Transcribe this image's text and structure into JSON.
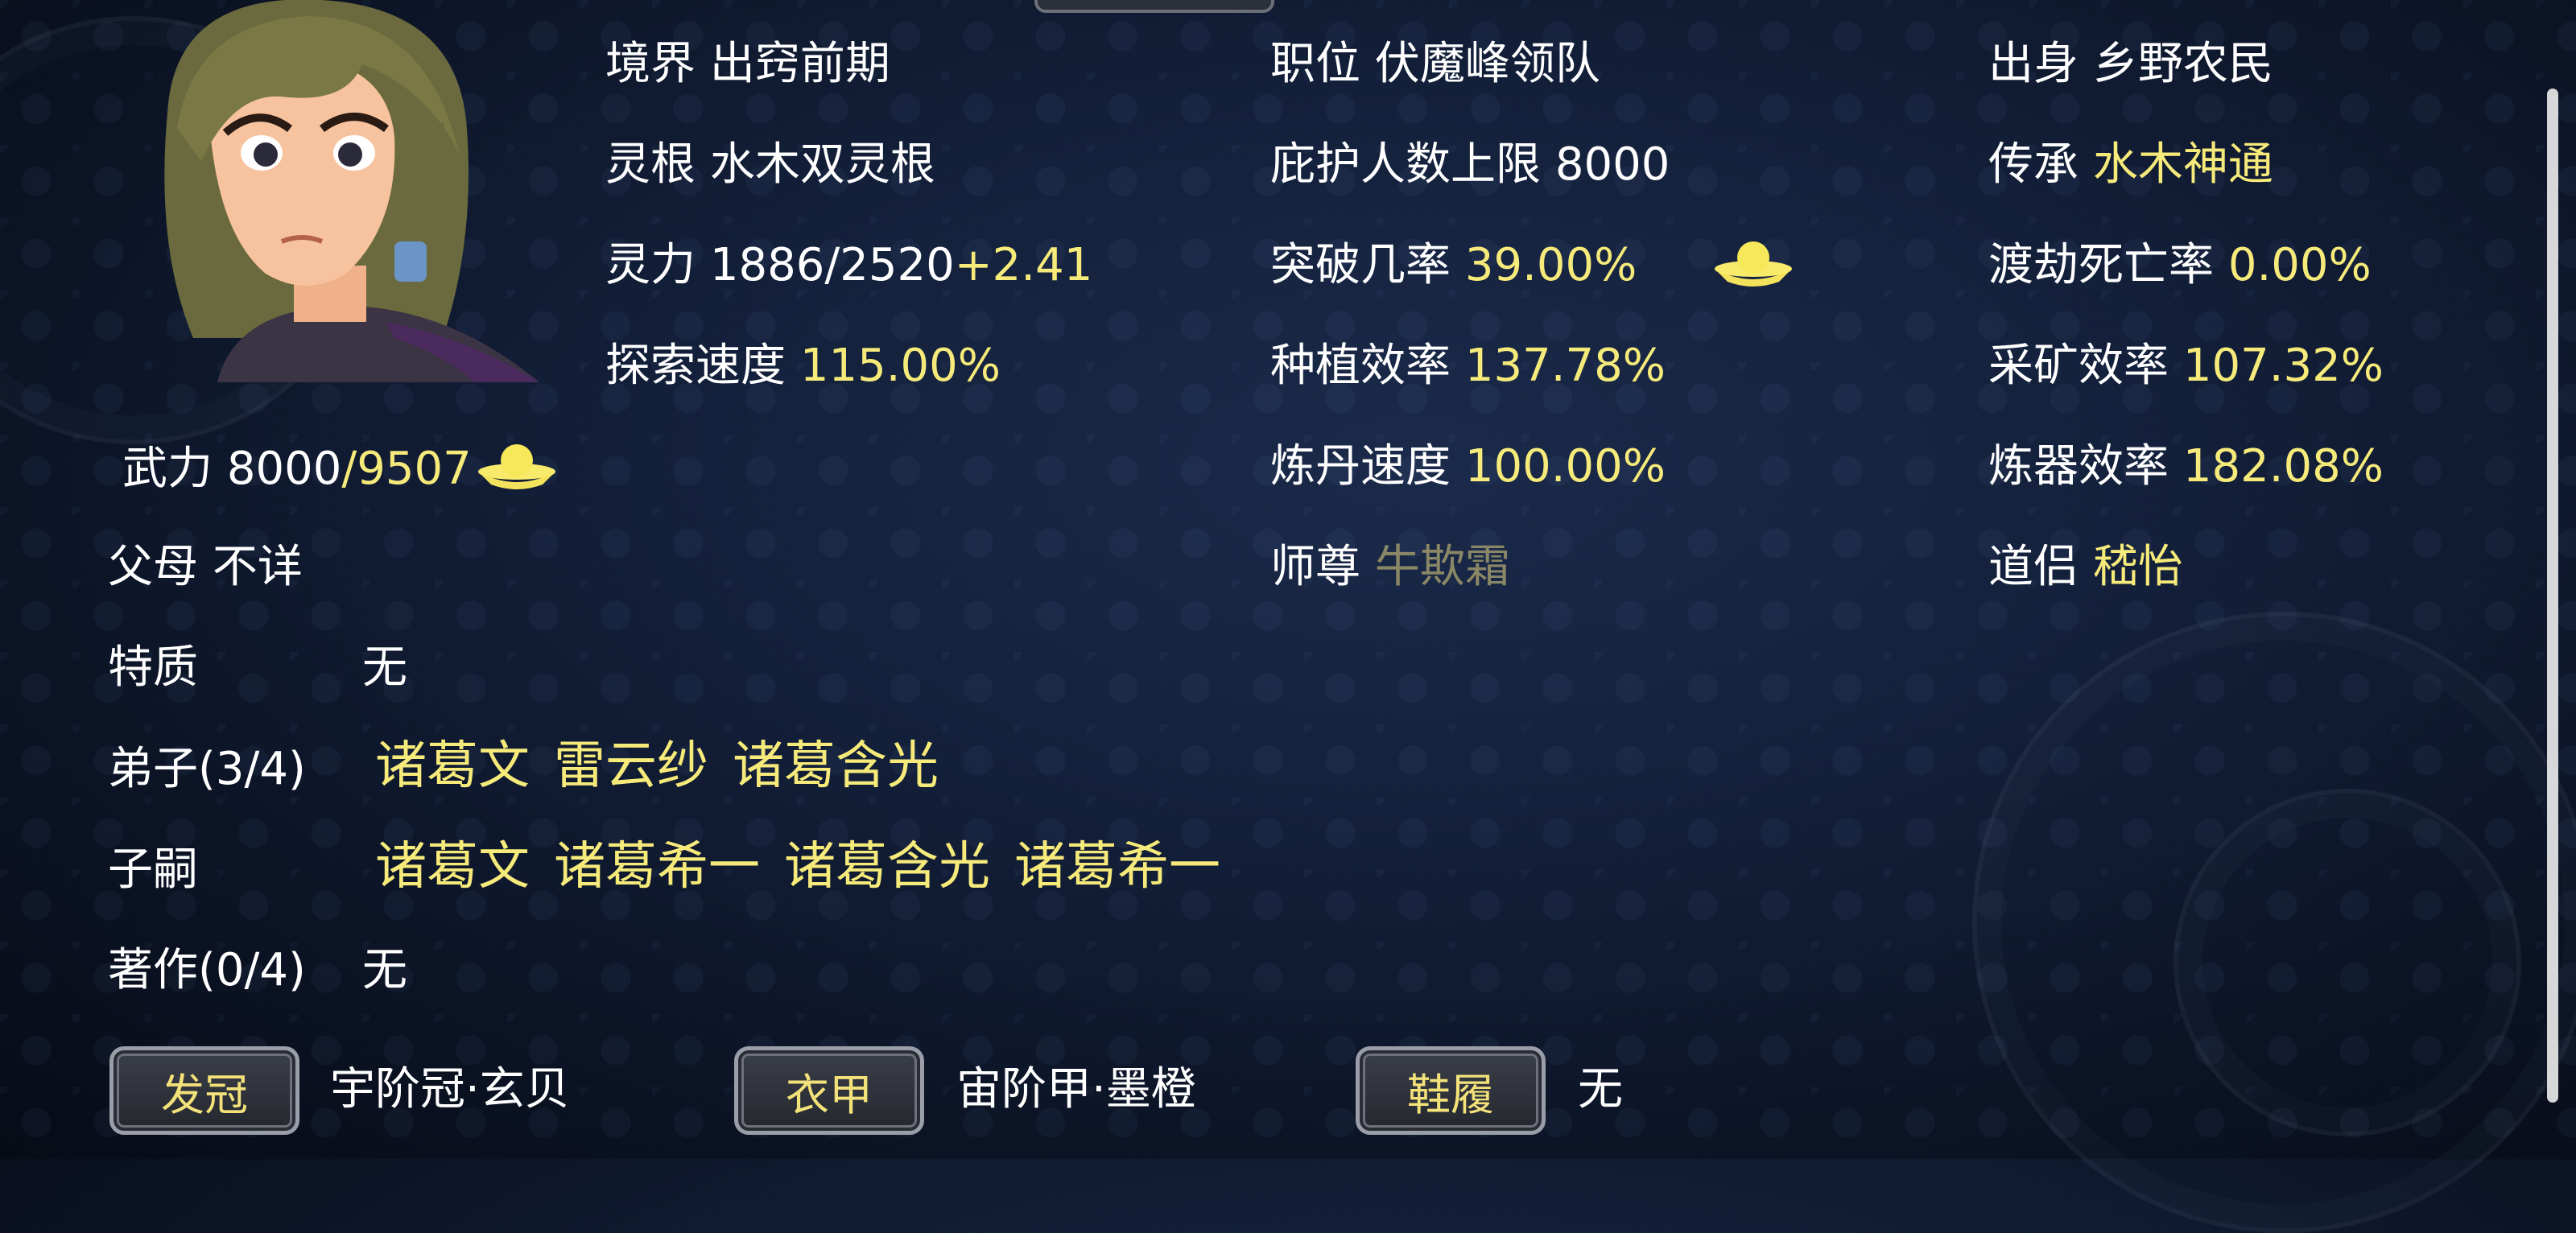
{
  "stats": {
    "realm_label": "境界",
    "realm_value": "出窍前期",
    "root_label": "灵根",
    "root_value": "水木双灵根",
    "spirit_label": "灵力",
    "spirit_value": "1886/2520",
    "spirit_bonus": "+2.41",
    "explore_label": "探索速度",
    "explore_value": "115.00%",
    "position_label": "职位",
    "position_value": "伏魔峰领队",
    "shelter_label": "庇护人数上限",
    "shelter_value": "8000",
    "breakthrough_label": "突破几率",
    "breakthrough_value": "39.00%",
    "plant_label": "种植效率",
    "plant_value": "137.78%",
    "alchemy_label": "炼丹速度",
    "alchemy_value": "100.00%",
    "master_label": "师尊",
    "master_value": "牛欺霜",
    "origin_label": "出身",
    "origin_value": "乡野农民",
    "inherit_label": "传承",
    "inherit_value": "水木神通",
    "tribulation_label": "渡劫死亡率",
    "tribulation_value": "0.00%",
    "mining_label": "采矿效率",
    "mining_value": "107.32%",
    "forge_label": "炼器效率",
    "forge_value": "182.08%",
    "partner_label": "道侣",
    "partner_value": "嵇怡",
    "force_label": "武力",
    "force_current": "8000",
    "force_max": "/9507",
    "parents_label": "父母",
    "parents_value": "不详",
    "trait_label": "特质",
    "trait_value": "无",
    "disciples_label": "弟子(3/4)",
    "disciples": [
      "诸葛文",
      "雷云纱",
      "诸葛含光"
    ],
    "heirs_label": "子嗣",
    "heirs": [
      "诸葛文",
      "诸葛希一",
      "诸葛含光",
      "诸葛希一"
    ],
    "works_label": "著作(0/4)",
    "works_value": "无"
  },
  "equipment": {
    "head_button": "发冠",
    "head_item": "宇阶冠·玄贝",
    "armor_button": "衣甲",
    "armor_item": "宙阶甲·墨橙",
    "shoes_button": "鞋履",
    "shoes_item": "无"
  },
  "icons": {
    "gold_ingot": "gold-ingot-icon"
  },
  "colors": {
    "highlight": "#f6ea7a",
    "dim": "#8a8766",
    "text": "#ffffff",
    "background": "#14213c"
  }
}
